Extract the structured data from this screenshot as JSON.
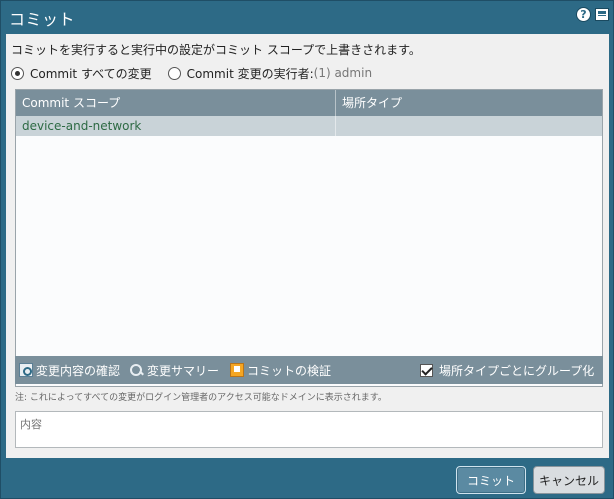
{
  "dialog": {
    "title": "コミット",
    "help_icon": "help-icon",
    "maximize_icon": "maximize-icon"
  },
  "description": "コミットを実行すると実行中の設定がコミット スコープで上書きされます。",
  "commit_options": {
    "all_changes_label": "Commit すべての変更",
    "by_user_label": "Commit 変更の実行者:",
    "by_user_value": "(1) admin",
    "selected": "all_changes"
  },
  "table": {
    "columns": [
      "Commit スコープ",
      "場所タイプ"
    ],
    "rows": [
      {
        "scope": "device-and-network",
        "location_type": ""
      }
    ]
  },
  "toolbar": {
    "preview_label": "変更内容の確認",
    "summary_label": "変更サマリー",
    "validate_label": "コミットの検証",
    "group_label": "場所タイプごとにグループ化",
    "group_checked": true
  },
  "note": "注: これによってすべての変更がログイン管理者のアクセス可能なドメインに表示されます。",
  "description_field": {
    "placeholder": "内容",
    "value": ""
  },
  "buttons": {
    "commit": "コミット",
    "cancel": "キャンセル"
  },
  "colors": {
    "title_bar": "#2d6a86",
    "header_bg": "#7a8f9b",
    "selected_row": "#c9d3d8"
  }
}
